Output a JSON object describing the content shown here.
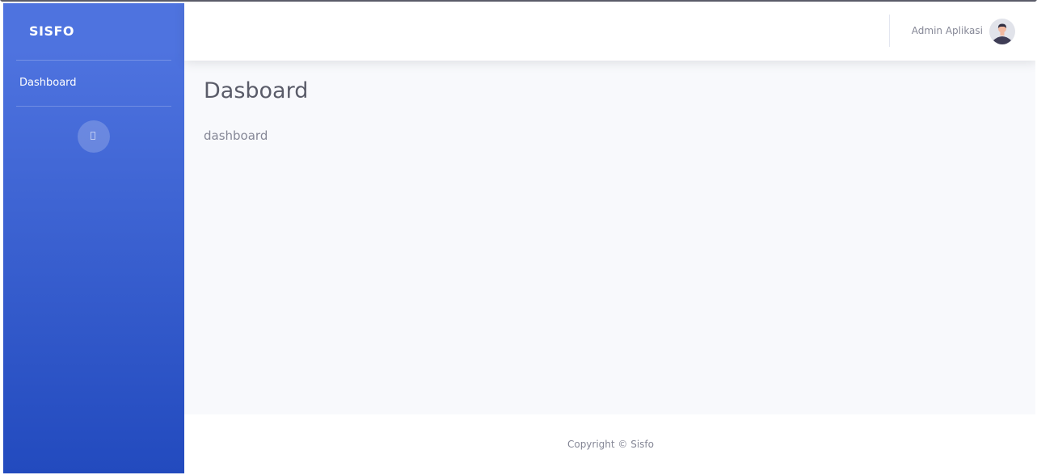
{
  "sidebar": {
    "brand": "SISFO",
    "items": [
      {
        "label": "Dashboard",
        "icon": "dashboard"
      }
    ],
    "toggle_icon": "sidebar-toggle-icon"
  },
  "topbar": {
    "user_name": "Admin Aplikasi",
    "avatar_icon": "user-avatar-icon"
  },
  "main": {
    "title": "Dasboard",
    "text": "dashboard"
  },
  "footer": {
    "copyright": "Copyright © Sisfo"
  },
  "colors": {
    "sidebar_gradient_start": "#4e73df",
    "sidebar_gradient_end": "#224abe",
    "content_bg": "#f8f9fc",
    "text_muted": "#858796",
    "heading": "#5a5c69"
  }
}
